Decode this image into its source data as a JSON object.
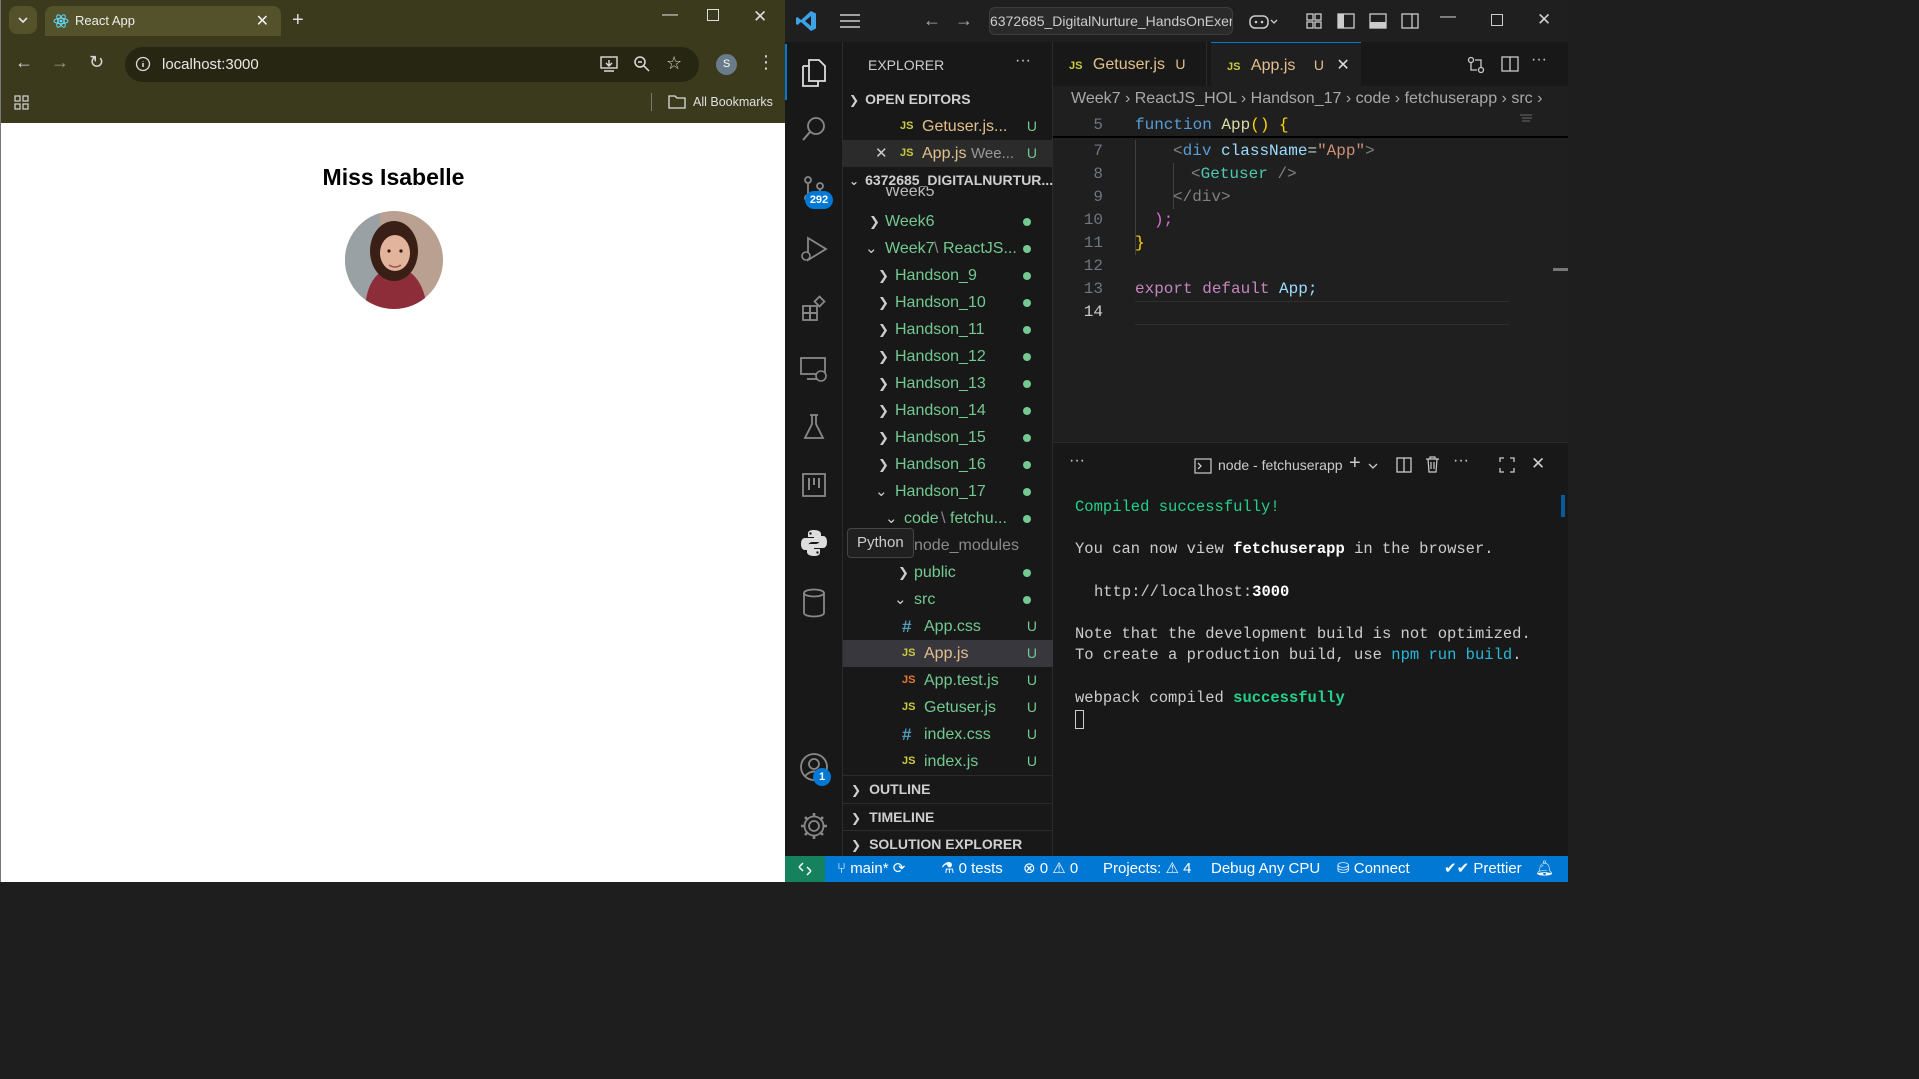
{
  "browser": {
    "tab_title": "React App",
    "url": "localhost:3000",
    "profile_initial": "S",
    "bookmarks_label": "All Bookmarks"
  },
  "page": {
    "heading": "Miss Isabelle"
  },
  "vscode": {
    "search_text": "6372685_DigitalNurture_HandsOnExer",
    "explorer_title": "EXPLORER",
    "open_editors_label": "OPEN EDITORS",
    "open_editors": [
      {
        "name": "Getuser.js...",
        "status": "U"
      },
      {
        "name": "App.js",
        "detail": "Wee...",
        "status": "U"
      }
    ],
    "workspace_label": "6372685_DIGITALNURTUR...",
    "tree": {
      "week5": "Week5",
      "week6": "Week6",
      "week7": "Week7",
      "week7_sep": "\\",
      "week7_sub": "ReactJS...",
      "handsons": [
        "Handson_9",
        "Handson_10",
        "Handson_11",
        "Handson_12",
        "Handson_13",
        "Handson_14",
        "Handson_15",
        "Handson_16",
        "Handson_17"
      ],
      "code": "code",
      "code_sep": "\\",
      "code_sub": "fetchu...",
      "node_modules": "node_modules",
      "public": "public",
      "src": "src",
      "files": [
        {
          "icon": "#",
          "name": "App.css",
          "status": "U"
        },
        {
          "icon": "JS",
          "name": "App.js",
          "status": "U"
        },
        {
          "icon": "JS",
          "name": "App.test.js",
          "status": "U"
        },
        {
          "icon": "JS",
          "name": "Getuser.js",
          "status": "U"
        },
        {
          "icon": "#",
          "name": "index.css",
          "status": "U"
        },
        {
          "icon": "JS",
          "name": "index.js",
          "status": "U"
        }
      ]
    },
    "tooltip": "Python",
    "bottom_sections": [
      "OUTLINE",
      "TIMELINE",
      "SOLUTION EXPLORER"
    ],
    "scm_badge": "292",
    "accounts_badge": "1",
    "tabs": [
      {
        "name": "Getuser.js",
        "status": "U"
      },
      {
        "name": "App.js",
        "status": "U"
      }
    ],
    "breadcrumb": [
      "Week7",
      "ReactJS_HOL",
      "Handson_17",
      "code",
      "fetchuserapp",
      "src"
    ],
    "code_lines": [
      {
        "n": "5"
      },
      {
        "n": "7"
      },
      {
        "n": "8"
      },
      {
        "n": "9"
      },
      {
        "n": "10"
      },
      {
        "n": "11"
      },
      {
        "n": "12"
      },
      {
        "n": "13"
      },
      {
        "n": "14"
      }
    ],
    "code_text": {
      "l5_kw": "function",
      "l5_fn": "App",
      "l5_paren": "()",
      "l5_brace": "{",
      "l7_open": "<",
      "l7_tag": "div",
      "l7_attr": "className",
      "l7_eq": "=",
      "l7_str": "\"App\"",
      "l7_close": ">",
      "l8_open": "<",
      "l8_tag": "Getuser",
      "l8_close": "/>",
      "l9_tag": "</div>",
      "l10": ");",
      "l11": "}",
      "l13_kw1": "export",
      "l13_kw2": "default",
      "l13_id": "App;"
    },
    "terminal": {
      "title": "node - fetchuserapp",
      "compiled": "Compiled successfully!",
      "view_prefix": "You can now view ",
      "app_name": "fetchuserapp",
      "view_suffix": " in the browser.",
      "url_label": "http://localhost:",
      "url_port": "3000",
      "note1": "Note that the development build is not optimized.",
      "note2_prefix": "To create a production build, use ",
      "note2_cmd": "npm run build",
      "note2_suffix": ".",
      "webpack_prefix": "webpack compiled ",
      "webpack_status": "successfully"
    },
    "status": {
      "branch": "main*",
      "tests": "0 tests",
      "errors": "0",
      "warnings": "0",
      "projects": "Projects:",
      "projects_count": "4",
      "debug": "Debug Any CPU",
      "connect": "Connect",
      "prettier": "Prettier"
    }
  }
}
